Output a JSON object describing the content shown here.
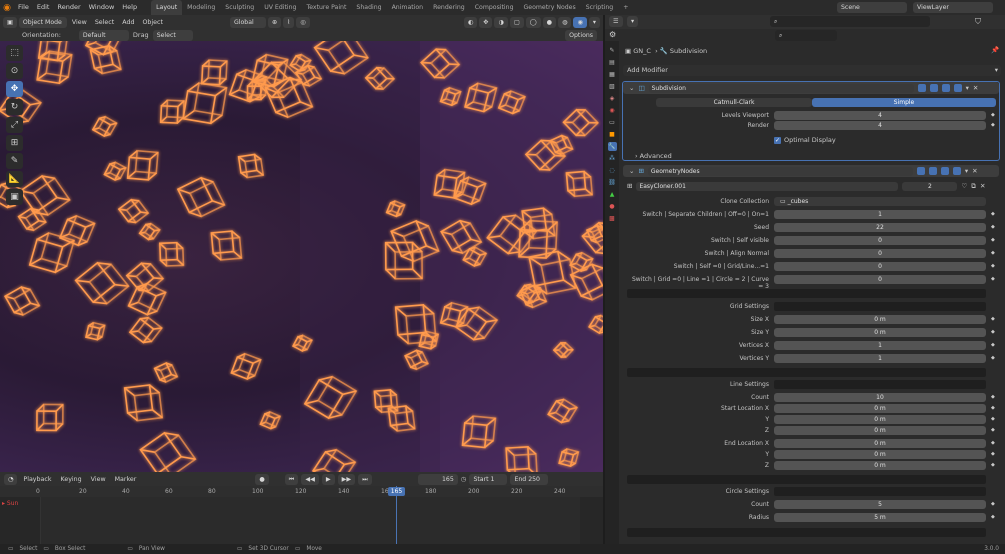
{
  "topbar": {
    "menus": [
      "File",
      "Edit",
      "Render",
      "Window",
      "Help"
    ],
    "workspaces": [
      "Layout",
      "Modeling",
      "Sculpting",
      "UV Editing",
      "Texture Paint",
      "Shading",
      "Animation",
      "Rendering",
      "Compositing",
      "Geometry Nodes",
      "Scripting"
    ],
    "active_workspace": "Layout",
    "scene": "Scene",
    "view_layer": "ViewLayer"
  },
  "viewport_header": {
    "mode": "Object Mode",
    "menus": [
      "View",
      "Select",
      "Add",
      "Object"
    ],
    "transform": "Global"
  },
  "viewport_options": {
    "orientation_label": "Orientation:",
    "orientation_value": "Default",
    "drag_label": "Drag",
    "drag_value": "Select Box",
    "options": "Options"
  },
  "timeline": {
    "menus": [
      "Playback",
      "Keying",
      "View",
      "Marker"
    ],
    "current_frame": "165",
    "start_label": "Start",
    "start": "1",
    "end_label": "End",
    "end": "250",
    "ruler": [
      "0",
      "20",
      "40",
      "60",
      "80",
      "100",
      "120",
      "140",
      "160",
      "165",
      "180",
      "200",
      "220",
      "240"
    ],
    "track_label": "Sun"
  },
  "status_bar": {
    "select": "Select",
    "select_box": "Box Select",
    "pan_view": "Pan View",
    "cursor": "Set 3D Cursor",
    "move": "Move",
    "version": "3.0.0"
  },
  "properties": {
    "breadcrumb_object": "GN_C",
    "breadcrumb_modifier": "Subdivision",
    "add_modifier": "Add Modifier",
    "subdivision": {
      "name": "Subdivision",
      "mode_a": "Catmull-Clark",
      "mode_b": "Simple",
      "levels_viewport_label": "Levels Viewport",
      "levels_viewport": "4",
      "render_label": "Render",
      "render": "4",
      "optimal_display": "Optimal Display",
      "advanced": "Advanced"
    },
    "geonodes": {
      "name": "GeometryNodes",
      "node_group": "EasyCloner.001",
      "users": "2",
      "rows": [
        {
          "label": "Clone Collection",
          "value": "_cubes"
        },
        {
          "label": "Switch | Separate Children | Off=0 | On=1",
          "value": "1"
        },
        {
          "label": "Seed",
          "value": "22"
        },
        {
          "label": "Switch | Self visible",
          "value": "0"
        },
        {
          "label": "Switch | Align Normal",
          "value": "0"
        },
        {
          "label": "Switch | Self =0 | Grid/Line...=1",
          "value": "0"
        },
        {
          "label": "Switch | Grid =0 | Line =1 | Circle = 2 | Curve = 3",
          "value": "0"
        }
      ],
      "grid_settings": "Grid Settings",
      "grid": [
        {
          "label": "Size X",
          "value": "0 m"
        },
        {
          "label": "Size Y",
          "value": "0 m"
        },
        {
          "label": "Vertices X",
          "value": "1"
        },
        {
          "label": "Vertices Y",
          "value": "1"
        }
      ],
      "line_settings": "Line Settings",
      "line": [
        {
          "label": "Count",
          "value": "10"
        },
        {
          "label": "Start Location X",
          "value": "0 m"
        },
        {
          "label": "Y",
          "value": "0 m"
        },
        {
          "label": "Z",
          "value": "0 m"
        },
        {
          "label": "End Location X",
          "value": "0 m"
        },
        {
          "label": "Y",
          "value": "0 m"
        },
        {
          "label": "Z",
          "value": "0 m"
        }
      ],
      "circle_settings": "Circle Settings",
      "circle": [
        {
          "label": "Count",
          "value": "5"
        },
        {
          "label": "Radius",
          "value": "5 m"
        }
      ]
    }
  },
  "colors": {
    "accent": "#4772b3",
    "glow": "#ff9a4d",
    "panel": "#2b2b2b"
  }
}
